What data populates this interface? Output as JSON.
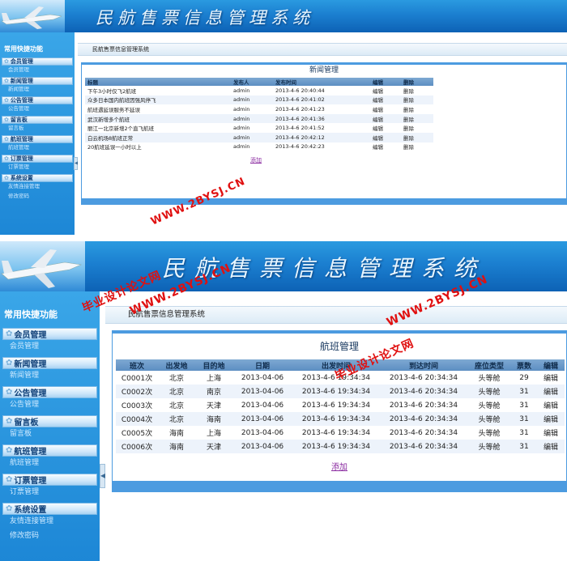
{
  "system_title": "民航售票信息管理系统",
  "sidebar": {
    "heading": "常用快捷功能",
    "groups": [
      {
        "label": "会员管理",
        "items": [
          "会员管理"
        ]
      },
      {
        "label": "新闻管理",
        "items": [
          "新闻管理"
        ]
      },
      {
        "label": "公告管理",
        "items": [
          "公告管理"
        ]
      },
      {
        "label": "留言板",
        "items": [
          "留言板"
        ]
      },
      {
        "label": "航班管理",
        "items": [
          "航班管理"
        ]
      },
      {
        "label": "订票管理",
        "items": [
          "订票管理"
        ]
      },
      {
        "label": "系统设置",
        "items": [
          "友情连接管理",
          "修改密码"
        ]
      }
    ]
  },
  "breadcrumb": "民航售票信息管理系统",
  "news_panel": {
    "title": "新闻管理",
    "columns": [
      "标题",
      "发布人",
      "发布时间",
      "编辑",
      "删除"
    ],
    "rows": [
      [
        "下午3小时仅飞2航班",
        "admin",
        "2013-4-6 20:40:44",
        "编辑",
        "删除"
      ],
      [
        "众多日本国内航班因强风停飞",
        "admin",
        "2013-4-6 20:41:02",
        "编辑",
        "删除"
      ],
      [
        "航班遇延误服务不延误",
        "admin",
        "2013-4-6 20:41:23",
        "编辑",
        "删除"
      ],
      [
        "武汉新增多个航班",
        "admin",
        "2013-4-6 20:41:36",
        "编辑",
        "删除"
      ],
      [
        "丽江一北京新增2个直飞航班",
        "admin",
        "2013-4-6 20:41:52",
        "编辑",
        "删除"
      ],
      [
        "白云机场8航班正常",
        "admin",
        "2013-4-6 20:42:12",
        "编辑",
        "删除"
      ],
      [
        "20航班延误一小时以上",
        "admin",
        "2013-4-6 20:42:23",
        "编辑",
        "删除"
      ]
    ],
    "add_label": "添加"
  },
  "flight_panel": {
    "title": "航班管理",
    "columns": [
      "班次",
      "出发地",
      "目的地",
      "日期",
      "出发时间",
      "到达时间",
      "座位类型",
      "票数",
      "编辑"
    ],
    "rows": [
      [
        "C0001次",
        "北京",
        "上海",
        "2013-04-06",
        "2013-4-6 19:34:34",
        "2013-4-6 20:34:34",
        "头等舱",
        "29",
        "编辑"
      ],
      [
        "C0002次",
        "北京",
        "南京",
        "2013-04-06",
        "2013-4-6 19:34:34",
        "2013-4-6 20:34:34",
        "头等舱",
        "31",
        "编辑"
      ],
      [
        "C0003次",
        "北京",
        "天津",
        "2013-04-06",
        "2013-4-6 19:34:34",
        "2013-4-6 20:34:34",
        "头等舱",
        "31",
        "编辑"
      ],
      [
        "C0004次",
        "北京",
        "海南",
        "2013-04-06",
        "2013-4-6 19:34:34",
        "2013-4-6 20:34:34",
        "头等舱",
        "31",
        "编辑"
      ],
      [
        "C0005次",
        "海南",
        "上海",
        "2013-04-06",
        "2013-4-6 19:34:34",
        "2013-4-6 20:34:34",
        "头等舱",
        "31",
        "编辑"
      ],
      [
        "C0006次",
        "海南",
        "天津",
        "2013-04-06",
        "2013-4-6 19:34:34",
        "2013-4-6 20:34:34",
        "头等舱",
        "31",
        "编辑"
      ]
    ],
    "add_label": "添加"
  },
  "watermarks": {
    "site": "WWW.2BYSJ.CN",
    "name": "毕业设计论文网"
  },
  "colors": {
    "banner": "#1b7fd0",
    "sidebar": "#2a96e0",
    "panel_border": "#4c9be0",
    "table_header": "#6e9ccb",
    "watermark": "#e01010",
    "link": "#8a2aa0"
  }
}
